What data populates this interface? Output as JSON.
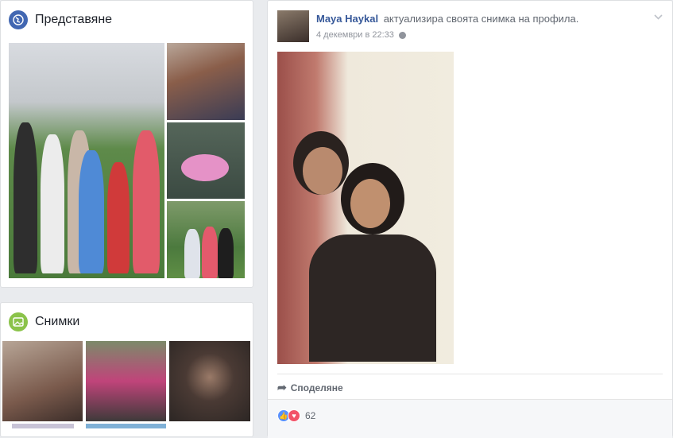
{
  "intro": {
    "title": "Представяне",
    "icon": "globe-icon"
  },
  "photos": {
    "title": "Снимки",
    "icon": "photo-icon"
  },
  "post": {
    "author": "Maya Haykal",
    "action": "актуализира своята снимка на профила.",
    "timestamp": "4 декември в 22:33",
    "privacy_icon": "public-globe-icon",
    "share_label": "Споделяне",
    "reaction_count": "62",
    "reaction_icons": [
      "like-icon",
      "love-icon"
    ]
  },
  "colors": {
    "link": "#365899",
    "like": "#5890ff",
    "love": "#f25268",
    "page_bg": "#e9ebee"
  }
}
